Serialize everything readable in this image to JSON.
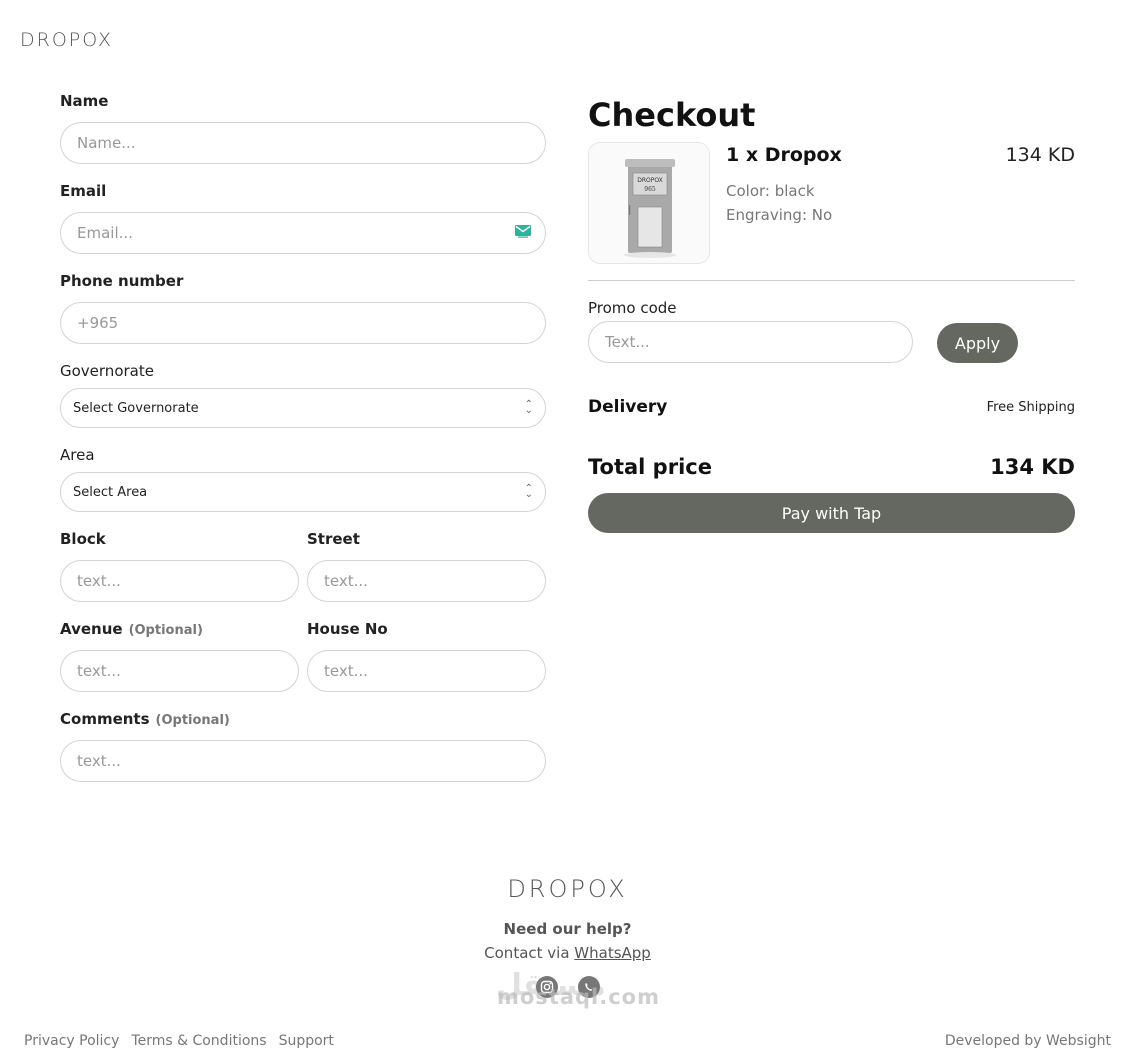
{
  "brand": {
    "logo_text": "DROPOX"
  },
  "form": {
    "name": {
      "label": "Name",
      "placeholder": "Name..."
    },
    "email": {
      "label": "Email",
      "placeholder": "Email..."
    },
    "phone": {
      "label": "Phone number",
      "placeholder": "+965"
    },
    "governorate": {
      "label": "Governorate",
      "value": "Select Governorate"
    },
    "area": {
      "label": "Area",
      "value": "Select Area"
    },
    "block": {
      "label": "Block",
      "placeholder": "text..."
    },
    "street": {
      "label": "Street",
      "placeholder": "text..."
    },
    "avenue": {
      "label": "Avenue",
      "optional": "(Optional)",
      "placeholder": "text..."
    },
    "house": {
      "label": "House No",
      "placeholder": "text..."
    },
    "comments": {
      "label": "Comments",
      "optional": "(Optional)",
      "placeholder": "text..."
    }
  },
  "checkout": {
    "title": "Checkout",
    "item": {
      "name": "1 x Dropox",
      "price": "134 KD",
      "color": "Color: black",
      "engraving": "Engraving: No",
      "image_label_brand": "DROPOX",
      "image_label_number": "965"
    },
    "promo": {
      "label": "Promo code",
      "placeholder": "Text...",
      "apply_label": "Apply"
    },
    "delivery": {
      "label": "Delivery",
      "value": "Free Shipping"
    },
    "total": {
      "label": "Total price",
      "value": "134 KD"
    },
    "pay_label": "Pay with Tap"
  },
  "footer": {
    "logo_text": "DROPOX",
    "help": "Need our help?",
    "contact_prefix": "Contact via ",
    "contact_link": "WhatsApp",
    "watermark_ar": "مستقل",
    "watermark": "mostaql.com",
    "links": [
      "Privacy Policy",
      "Terms & Conditions",
      "Support"
    ],
    "developed_by": "Developed by Websight"
  },
  "colors": {
    "button_bg": "#656860",
    "border": "#d4d4d4",
    "muted_text": "#777777"
  }
}
